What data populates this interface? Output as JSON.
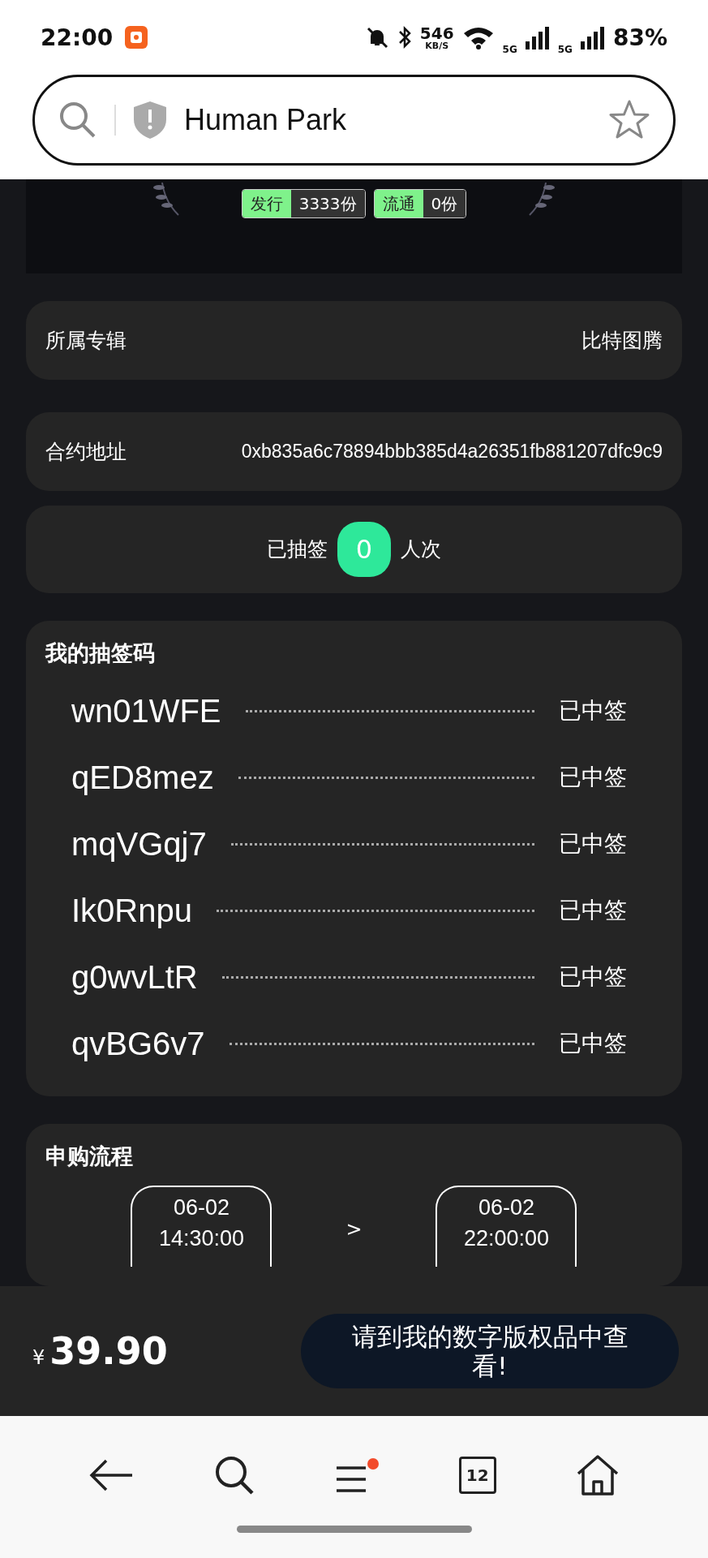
{
  "status_bar": {
    "time": "22:00",
    "speed": "546",
    "speed_unit": "KB/S",
    "network_1": "5G",
    "network_2": "5G",
    "battery": "83%"
  },
  "address_bar": {
    "title": "Human Park"
  },
  "banner": {
    "tags": [
      {
        "label": "发行",
        "value": "3333份"
      },
      {
        "label": "流通",
        "value": "0份"
      }
    ]
  },
  "info_rows": [
    {
      "label": "所属专辑",
      "value": "比特图腾"
    },
    {
      "label": "合约地址",
      "value": "0xb835a6c78894bbb385d4a26351fb881207dfc9c9"
    }
  ],
  "draw_count": {
    "prefix": "已抽签",
    "count": "0",
    "suffix": "人次"
  },
  "lottery_codes": {
    "title": "我的抽签码",
    "rows": [
      {
        "code": "wn01WFE",
        "status": "已中签"
      },
      {
        "code": "qED8mez",
        "status": "已中签"
      },
      {
        "code": "mqVGqj7",
        "status": "已中签"
      },
      {
        "code": "Ik0Rnpu",
        "status": "已中签"
      },
      {
        "code": "g0wvLtR",
        "status": "已中签"
      },
      {
        "code": "qvBG6v7",
        "status": "已中签"
      }
    ]
  },
  "process": {
    "title": "申购流程",
    "steps": [
      {
        "date": "06-02",
        "time": "14:30:00"
      },
      {
        "date": "06-02",
        "time": "22:00:00"
      }
    ],
    "separator": ">"
  },
  "purchase_bar": {
    "currency": "¥",
    "price": "39.90",
    "button": "请到我的数字版权品中查看!"
  },
  "nav_bar": {
    "tab_count": "12",
    "menu_badge": true
  }
}
